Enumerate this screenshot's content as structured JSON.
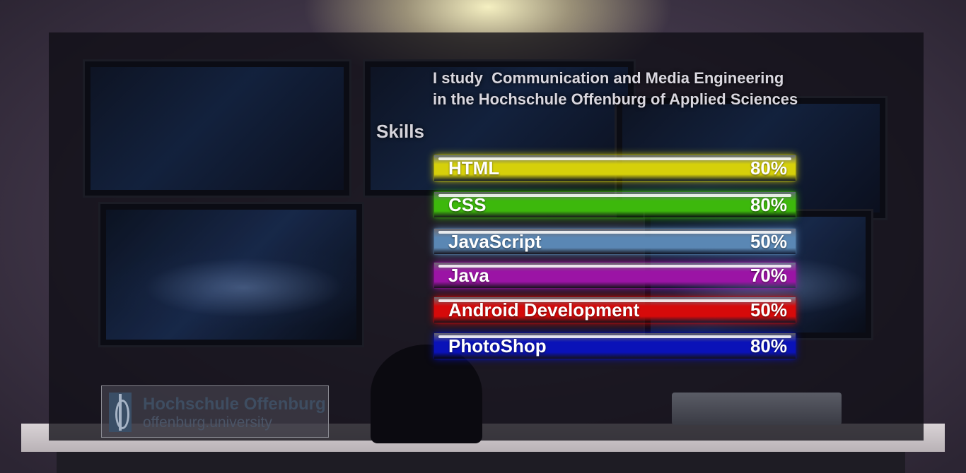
{
  "intro": {
    "line1": "I study  Communication and Media Engineering",
    "line2": "in the Hochschule Offenburg of Applied Sciences"
  },
  "skills": {
    "title": "Skills",
    "items": [
      {
        "name": "HTML",
        "percent_label": "80%",
        "percent": 80,
        "color": "#d6d00a"
      },
      {
        "name": "CSS",
        "percent_label": "80%",
        "percent": 80,
        "color": "#3db80c"
      },
      {
        "name": "JavaScript",
        "percent_label": "50%",
        "percent": 50,
        "color": "#5a87b4"
      },
      {
        "name": "Java",
        "percent_label": "70%",
        "percent": 70,
        "color": "#9b14a5"
      },
      {
        "name": "Android Development",
        "percent_label": "50%",
        "percent": 50,
        "color": "#d60a0a"
      },
      {
        "name": "PhotoShop",
        "percent_label": "80%",
        "percent": 80,
        "color": "#0a12b8"
      }
    ]
  },
  "logo": {
    "name": "Hochschule Offenburg",
    "url": "offenburg.university"
  }
}
